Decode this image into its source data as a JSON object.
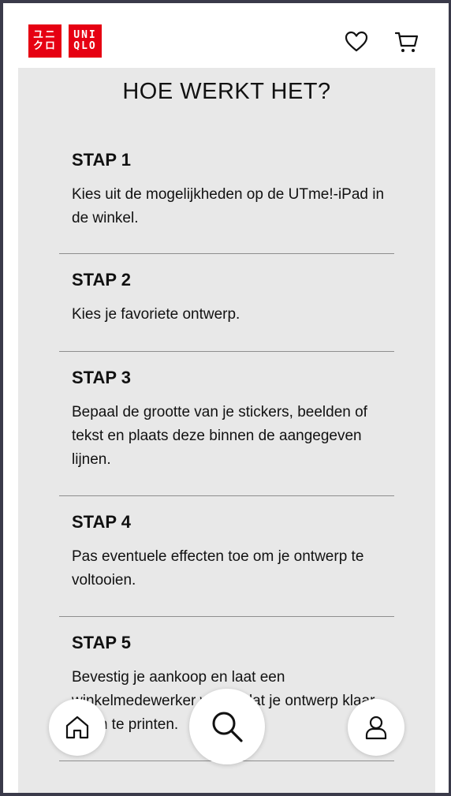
{
  "header": {
    "logo_left_top": "ユニ",
    "logo_left_bottom": "クロ",
    "logo_right_top": "UNI",
    "logo_right_bottom": "QLO",
    "icons": [
      "heart-icon",
      "cart-icon"
    ]
  },
  "main": {
    "title": "HOE WERKT HET?",
    "steps": [
      {
        "title": "STAP 1",
        "text": "Kies uit de mogelijkheden op de UTme!-iPad in de winkel."
      },
      {
        "title": "STAP 2",
        "text": "Kies je favoriete ontwerp."
      },
      {
        "title": "STAP 3",
        "text": "Bepaal de grootte van je stickers, beelden of tekst en plaats deze binnen de aangegeven lijnen."
      },
      {
        "title": "STAP 4",
        "text": "Pas eventuele effecten toe om je ontwerp te voltooien."
      },
      {
        "title": "STAP 5",
        "text": "Bevestig je aankoop en laat een winkelmedewerker weten dat je ontwerp klaar is om te printen."
      }
    ]
  },
  "bottom_nav": {
    "icons": [
      "home-icon",
      "search-icon",
      "account-icon"
    ]
  },
  "colors": {
    "brand_red": "#e60012",
    "content_bg": "#e8e8e8",
    "divider": "#8e8e8e"
  }
}
